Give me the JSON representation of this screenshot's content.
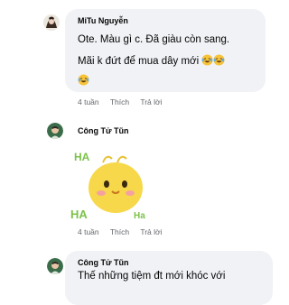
{
  "comments": [
    {
      "author": "MiTu Nguyễn",
      "lines": [
        "Ote. Màu gì c. Đã giàu còn sang.",
        "Mãi k đứt để mua dây mới"
      ],
      "actions": {
        "time": "4 tuần",
        "like": "Thích",
        "reply": "Trả lời"
      },
      "emoji": "laughing-crying-face"
    },
    {
      "author": "Công Tử Tũn",
      "sticker": {
        "text_top": "HA",
        "text_left": "HA",
        "text_right": "Ha"
      },
      "actions": {
        "time": "4 tuần",
        "like": "Thích",
        "reply": "Trả lời"
      }
    },
    {
      "author": "Công Tử Tũn",
      "lines": [
        "Thế những tiệm đt mới khóc với"
      ]
    }
  ],
  "colors": {
    "bubble": "#f0f2f5",
    "meta": "#65676b",
    "sticker_yellow": "#f6d84a",
    "sticker_text": "#7cc24a"
  }
}
